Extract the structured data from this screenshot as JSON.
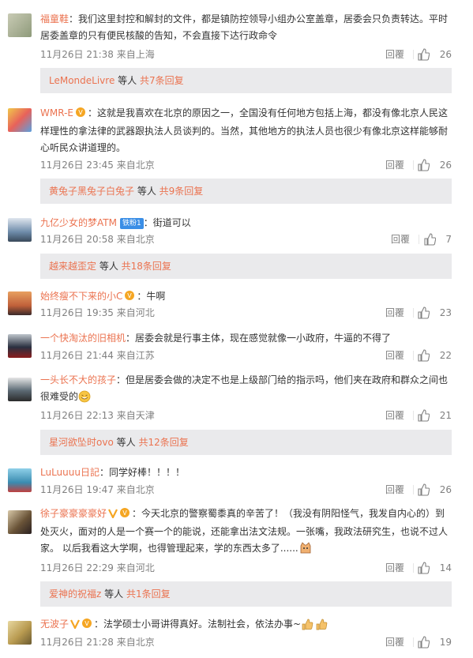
{
  "comments": [
    {
      "user": "福童鞋",
      "badge": false,
      "text": "：我们这里封控和解封的文件，都是镇防控领导小组办公室盖章，居委会只负责转达。平时居委盖章的只有便民核酸的告知，不会直接下达行政命令",
      "time": "11月26日 21:38 来自上海",
      "likes": "26",
      "replies": {
        "who": "LeMondeLivre",
        "mid": " 等人 ",
        "count": "共7条回复"
      }
    },
    {
      "user": "WMR-E",
      "badge": true,
      "text": "：这就是我喜欢在北京的原因之一，全国没有任何地方包括上海，都没有像北京人民这样理性的拿法律的武器跟执法人员谈判的。当然，其他地方的执法人员也很少有像北京这样能够耐心听民众讲道理的。",
      "time": "11月26日 23:45 来自北京",
      "likes": "26",
      "replies": {
        "who": "黄兔子黑兔子白兔子",
        "mid": " 等人 ",
        "count": "共9条回复"
      }
    },
    {
      "user": "九亿少女的梦ATM",
      "badge": false,
      "tag": "铁粉1",
      "text": "：街道可以",
      "time": "11月26日 20:58 来自北京",
      "likes": "7",
      "replies": {
        "who": "越来越歪定",
        "mid": " 等人 ",
        "count": "共18条回复"
      }
    },
    {
      "user": "始终瘦不下来的小C",
      "badge": true,
      "text": "：牛啊",
      "time": "11月26日 19:35 来自河北",
      "likes": "23"
    },
    {
      "user": "一个快淘汰的旧相机",
      "badge": false,
      "text": "：居委会就是行事主体，现在感觉就像一小政府，牛逼的不得了",
      "time": "11月26日 21:44 来自江苏",
      "likes": "22"
    },
    {
      "user": "一头长不大的孩子",
      "badge": false,
      "text": "：但是居委会做的决定不也是上级部门给的指示吗，他们夹在政府和群众之间也很难受的",
      "time": "11月26日 22:13 来自天津",
      "likes": "21",
      "replies": {
        "who": "星河欲坠时ovo",
        "mid": " 等人 ",
        "count": "共12条回复"
      }
    },
    {
      "user": "LuLuuuu日記",
      "badge": false,
      "text": "：同学好棒！！！！",
      "time": "11月26日 19:47 来自北京",
      "likes": "26"
    },
    {
      "user": "徐子豪豪豪豪好",
      "badge": true,
      "vip": true,
      "text": "：今天北京的警察蜀黍真的辛苦了！（我没有阴阳怪气，我发自内心的）到处灭火，面对的人是一个赛一个的能说，还能拿出法文法规。一张嘴，我政法研究生，也说不过人家。 以后我看这大学啊，也得管理起来，学的东西太多了......",
      "time": "11月26日 22:29 来自河北",
      "likes": "14",
      "replies": {
        "who": "爱神的祝福z",
        "mid": " 等人 ",
        "count": "共1条回复"
      }
    },
    {
      "user": "无波子",
      "badge": true,
      "vip": true,
      "text": "：法学硕士小哥讲得真好。法制社会，依法办事~",
      "time": "11月26日 21:28 来自北京",
      "likes": "19"
    }
  ],
  "labels": {
    "reply": "回覆"
  },
  "colors": {
    "username": "#eb7350",
    "meta": "#808080",
    "reply_bg": "#eaeaec"
  }
}
